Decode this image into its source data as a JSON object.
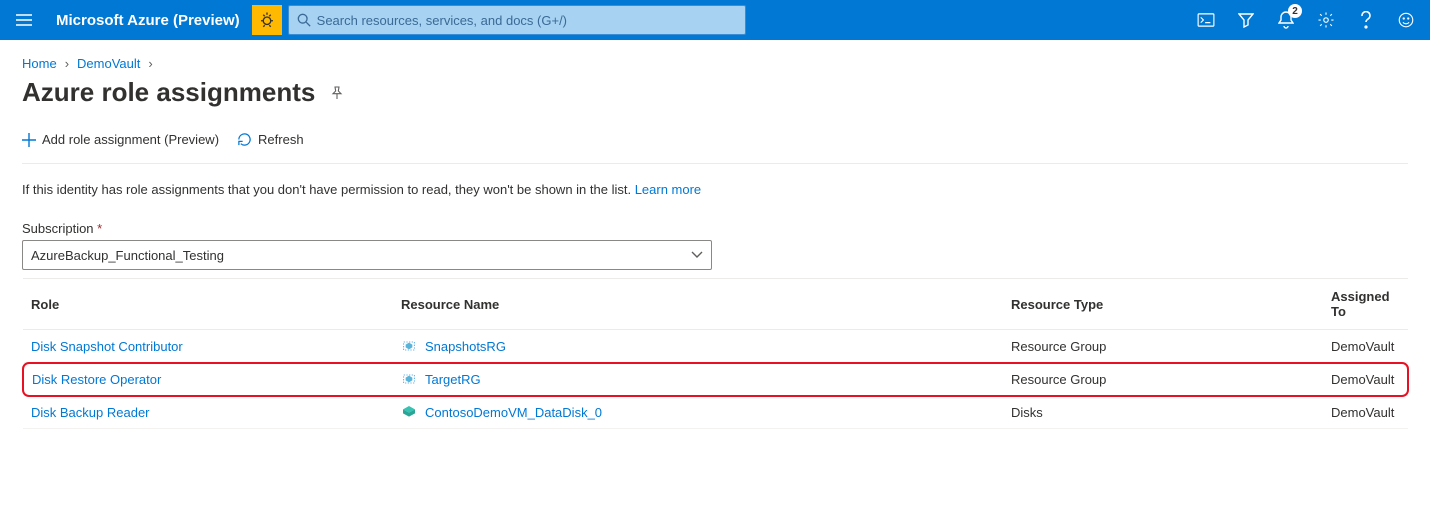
{
  "topbar": {
    "brand": "Microsoft Azure (Preview)",
    "search_placeholder": "Search resources, services, and docs (G+/)",
    "notification_count": "2"
  },
  "breadcrumb": {
    "home": "Home",
    "item1": "DemoVault"
  },
  "page": {
    "title": "Azure role assignments"
  },
  "toolbar": {
    "add_label": "Add role assignment (Preview)",
    "refresh_label": "Refresh"
  },
  "info": {
    "text": "If this identity has role assignments that you don't have permission to read, they won't be shown in the list. ",
    "learn_more": "Learn more"
  },
  "subscription": {
    "label": "Subscription",
    "value": "AzureBackup_Functional_Testing"
  },
  "table": {
    "headers": {
      "role": "Role",
      "resource_name": "Resource Name",
      "resource_type": "Resource Type",
      "assigned_to": "Assigned To"
    },
    "rows": [
      {
        "role": "Disk Snapshot Contributor",
        "resource_name": "SnapshotsRG",
        "resource_type": "Resource Group",
        "assigned_to": "DemoVault",
        "icon": "rg"
      },
      {
        "role": "Disk Restore Operator",
        "resource_name": "TargetRG",
        "resource_type": "Resource Group",
        "assigned_to": "DemoVault",
        "icon": "rg",
        "highlight": true
      },
      {
        "role": "Disk Backup Reader",
        "resource_name": "ContosoDemoVM_DataDisk_0",
        "resource_type": "Disks",
        "assigned_to": "DemoVault",
        "icon": "disk"
      }
    ]
  }
}
